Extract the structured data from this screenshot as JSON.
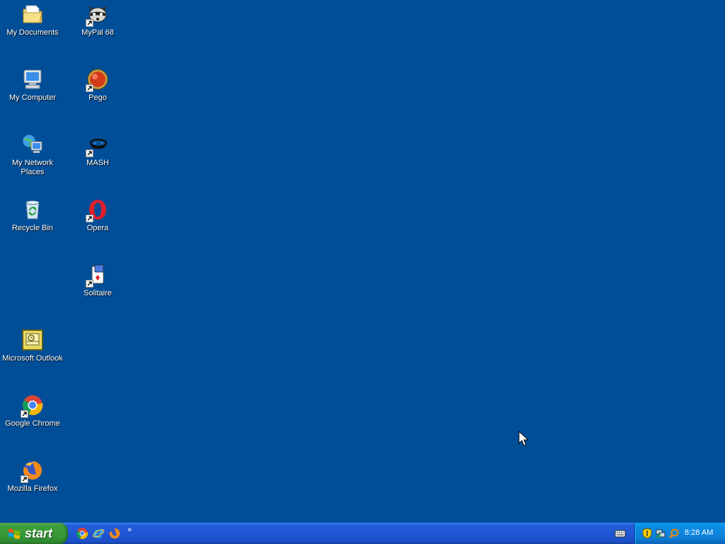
{
  "desktop": {
    "background": "#004e98",
    "icons": [
      {
        "label": "My Documents",
        "icon": "my-documents-icon",
        "shortcut": false
      },
      {
        "label": "MyPal 68",
        "icon": "mypal-icon",
        "shortcut": true
      },
      {
        "label": "My Computer",
        "icon": "my-computer-icon",
        "shortcut": false
      },
      {
        "label": "Pego",
        "icon": "pego-icon",
        "shortcut": true
      },
      {
        "label": "My Network Places",
        "icon": "network-places-icon",
        "shortcut": false
      },
      {
        "label": "MASH",
        "icon": "mash-icon",
        "shortcut": true
      },
      {
        "label": "Recycle Bin",
        "icon": "recycle-bin-icon",
        "shortcut": false
      },
      {
        "label": "Opera",
        "icon": "opera-icon",
        "shortcut": true
      },
      {
        "label": "Solitaire",
        "icon": "solitaire-icon",
        "shortcut": true
      },
      {
        "label": "Microsoft Outlook",
        "icon": "outlook-icon",
        "shortcut": false
      },
      {
        "label": "Google Chrome",
        "icon": "chrome-icon",
        "shortcut": true
      },
      {
        "label": "Mozilla Firefox",
        "icon": "firefox-icon",
        "shortcut": true
      }
    ]
  },
  "taskbar": {
    "start_label": "start",
    "quick_launch": [
      "chrome-icon",
      "internet-explorer-icon",
      "firefox-icon"
    ],
    "overflow": "»",
    "tray_icons": [
      "security-shield-icon",
      "network-icon",
      "search-icon"
    ],
    "clock": "8:28 AM"
  }
}
